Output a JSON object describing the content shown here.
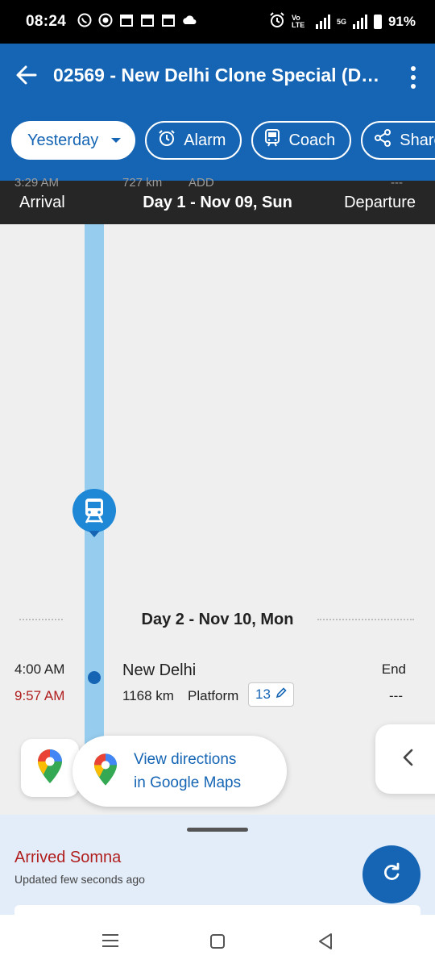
{
  "status_bar": {
    "time": "08:24",
    "network_label": "Vo LTE",
    "network_5g": "5G",
    "battery": "91%"
  },
  "app_bar": {
    "title": "02569 - New Delhi Clone Special (D…",
    "chips": {
      "date": "Yesterday",
      "alarm": "Alarm",
      "coach": "Coach",
      "share": "Share"
    },
    "accent_color": "#1565b4"
  },
  "day_header": {
    "prev_time": "3:29 AM",
    "prev_distance": "727 km",
    "prev_add": "ADD",
    "prev_dash": "---",
    "arrival_label": "Arrival",
    "day_label": "Day 1 - Nov 09, Sun",
    "departure_label": "Departure"
  },
  "timeline": {
    "day2_label": "Day 2 - Nov 10, Mon",
    "station": {
      "arrival_time": "4:00 AM",
      "actual_time": "9:57 AM",
      "name": "New Delhi",
      "distance": "1168 km",
      "platform_label": "Platform",
      "platform_number": "13",
      "departure": "End",
      "departure_actual": "---"
    }
  },
  "maps": {
    "directions_line1": "View directions",
    "directions_line2": "in Google Maps"
  },
  "bottom_sheet": {
    "status": "Arrived Somna",
    "updated": "Updated few seconds ago"
  }
}
